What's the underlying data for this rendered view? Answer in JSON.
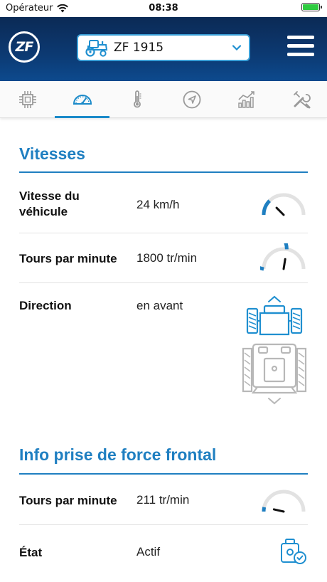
{
  "status_bar": {
    "carrier": "Opérateur",
    "time": "08:38",
    "battery_level": 1.0,
    "battery_color": "#2ecc40"
  },
  "header": {
    "logo_text": "ZF",
    "vehicle_name": "ZF 1915",
    "vehicle_icon": "tractor-icon",
    "dropdown_icon": "chevron-down-icon",
    "menu_icon": "hamburger-menu-icon",
    "colors": {
      "header_bg": "#0c3a73",
      "accent": "#1f7fc1"
    }
  },
  "tabs": [
    {
      "icon": "chip-icon",
      "active": false
    },
    {
      "icon": "speedometer-icon",
      "active": true
    },
    {
      "icon": "thermometer-icon",
      "active": false
    },
    {
      "icon": "navigation-icon",
      "active": false
    },
    {
      "icon": "chart-icon",
      "active": false
    },
    {
      "icon": "tools-icon",
      "active": false
    }
  ],
  "speeds": {
    "title": "Vitesses",
    "vehicle_speed": {
      "label": "Vitesse du\nvéhicule",
      "label_line1": "Vitesse du",
      "label_line2": "véhicule",
      "value": "24 km/h",
      "gauge_level": 0.25
    },
    "rpm": {
      "label": "Tours par minute",
      "value": "1800 tr/min",
      "gauge_level": 0.55
    },
    "direction": {
      "label": "Direction",
      "value": "en avant",
      "icon": "tractor-direction-forward-icon"
    }
  },
  "pto_front": {
    "title": "Info prise de force frontal",
    "rpm": {
      "label": "Tours par minute",
      "value": "211 tr/min",
      "gauge_level": 0.07
    },
    "state": {
      "label": "État",
      "value": "Actif",
      "icon": "pto-active-icon"
    }
  }
}
